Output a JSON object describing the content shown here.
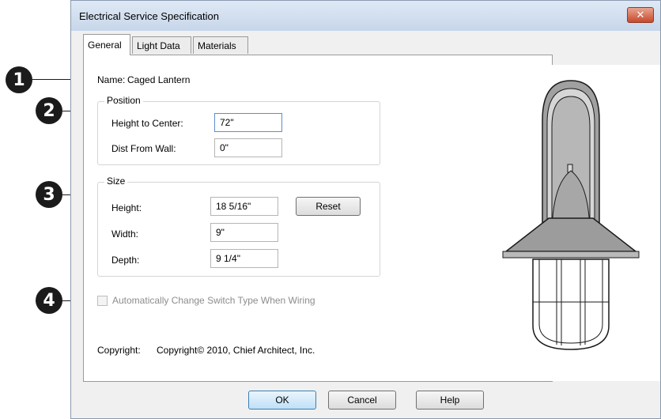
{
  "dialog": {
    "title": "Electrical Service Specification",
    "close_glyph": "✕",
    "tabs": [
      {
        "label": "General",
        "active": true
      },
      {
        "label": "Light Data",
        "active": false
      },
      {
        "label": "Materials",
        "active": false
      }
    ]
  },
  "callouts": [
    "1",
    "2",
    "3",
    "4"
  ],
  "general": {
    "name_label": "Name:",
    "name_value": "Caged Lantern",
    "position": {
      "legend": "Position",
      "height_to_center_label": "Height to Center:",
      "height_to_center_value": "72\"",
      "dist_from_wall_label": "Dist From Wall:",
      "dist_from_wall_value": "0\""
    },
    "size": {
      "legend": "Size",
      "height_label": "Height:",
      "height_value": "18 5/16\"",
      "reset_label": "Reset",
      "width_label": "Width:",
      "width_value": "9\"",
      "depth_label": "Depth:",
      "depth_value": "9 1/4\""
    },
    "auto_switch_label": "Automatically Change Switch Type When Wiring",
    "auto_switch_checked": false,
    "auto_switch_enabled": false,
    "copyright_label": "Copyright:",
    "copyright_value": "Copyright© 2010, Chief Architect, Inc."
  },
  "footer": {
    "ok_label": "OK",
    "cancel_label": "Cancel",
    "help_label": "Help"
  },
  "preview": {
    "icon": "caged-lantern-preview"
  }
}
